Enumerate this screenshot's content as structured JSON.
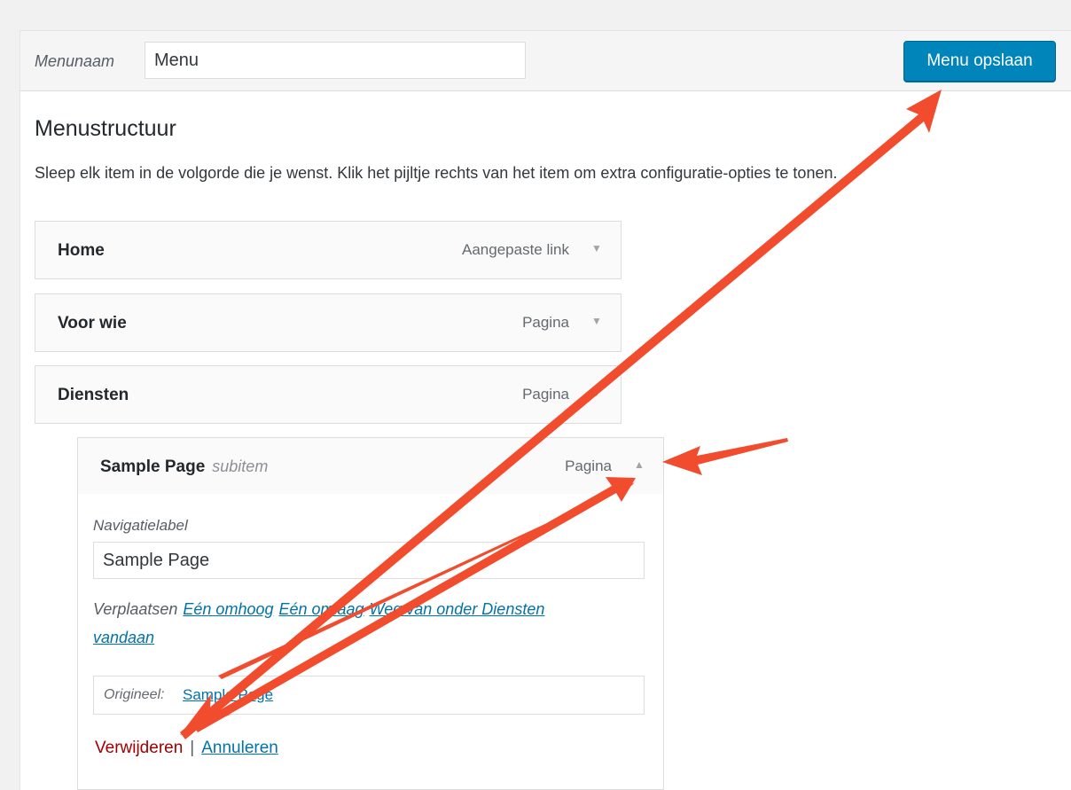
{
  "header": {
    "menu_name_label": "Menunaam",
    "menu_name_value": "Menu",
    "save_label": "Menu opslaan"
  },
  "structure": {
    "title": "Menustructuur",
    "instructions": "Sleep elk item in de volgorde die je wenst. Klik het pijltje rechts van het item om extra configuratie-opties te tonen."
  },
  "menu_items": [
    {
      "name": "Home",
      "type": "Aangepaste link"
    },
    {
      "name": "Voor wie",
      "type": "Pagina"
    },
    {
      "name": "Diensten",
      "type": "Pagina"
    }
  ],
  "subitem": {
    "name": "Sample Page",
    "tag": "subitem",
    "type": "Pagina"
  },
  "panel": {
    "nav_label": "Navigatielabel",
    "nav_value": "Sample Page",
    "move_label": "Verplaatsen",
    "move_up": "Eén omhoog",
    "move_down": "Eén omlaag",
    "move_out_a": "Weg van onder Diensten",
    "move_out_b": "vandaan",
    "original_label": "Origineel:",
    "original_link": "Sample Page",
    "delete_label": "Verwijderen",
    "separator": "|",
    "cancel_label": "Annuleren"
  },
  "icons": {
    "collapsed_arrow": "triangle-down-icon",
    "expanded_arrow": "triangle-up-icon",
    "annotation": "red-arrow-annotation"
  },
  "colors": {
    "primary": "#0085ba",
    "link": "#0073aa",
    "delete": "#a00000",
    "annotation": "#f04c2d"
  }
}
